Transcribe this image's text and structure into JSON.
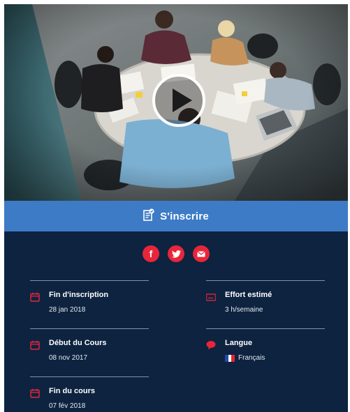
{
  "video": {
    "alt_subject": "students-studying-around-table",
    "play_icon": "play-icon"
  },
  "enroll": {
    "label": "S'inscrire",
    "icon": "register-form-icon",
    "color": "#3d7bc6"
  },
  "social": [
    {
      "name": "facebook",
      "icon": "facebook-icon",
      "glyph": "f"
    },
    {
      "name": "twitter",
      "icon": "twitter-icon",
      "glyph": ""
    },
    {
      "name": "email",
      "icon": "mail-icon",
      "glyph": ""
    }
  ],
  "details": {
    "inscription_end": {
      "title": "Fin d'inscription",
      "value": "28 jan 2018",
      "icon": "calendar-icon"
    },
    "course_start": {
      "title": "Début du Cours",
      "value": "08 nov 2017",
      "icon": "calendar-icon"
    },
    "course_end": {
      "title": "Fin du cours",
      "value": "07 fév 2018",
      "icon": "calendar-icon"
    },
    "effort": {
      "title": "Effort estimé",
      "value": "3 h/semaine",
      "icon": "laptop-icon"
    },
    "language": {
      "title": "Langue",
      "value": "Français",
      "icon": "speech-bubble-icon",
      "flag": "france-flag-icon"
    }
  },
  "colors": {
    "panel_bg": "#0d2340",
    "accent_red": "#e8263a",
    "divider": "#8093ad"
  }
}
